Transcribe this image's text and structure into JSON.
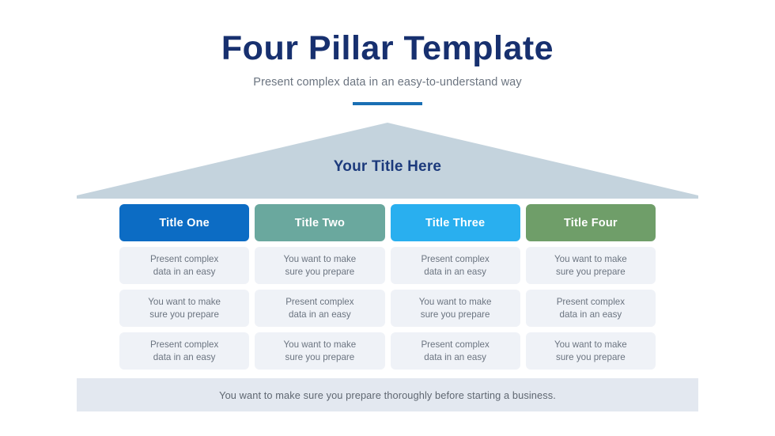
{
  "header": {
    "title": "Four Pillar Template",
    "subtitle": "Present complex data in an easy-to-understand way",
    "accent_color": "#1a6fb4",
    "title_color": "#17306f"
  },
  "roof": {
    "title": "Your Title Here",
    "fill_color": "#c4d3dd",
    "title_color": "#1c3a7c"
  },
  "columns": [
    {
      "title": "Title One",
      "color": "#0c6cc4",
      "cells": [
        "Present complex\ndata in an easy",
        "You want to make\nsure you prepare",
        "Present complex\ndata in an easy"
      ]
    },
    {
      "title": "Title Two",
      "color": "#6aa89e",
      "cells": [
        "You want to make\nsure you prepare",
        "Present complex\ndata in an easy",
        "You want to make\nsure you prepare"
      ]
    },
    {
      "title": "Title Three",
      "color": "#29afef",
      "cells": [
        "Present complex\ndata in an easy",
        "You want to make\nsure you prepare",
        "Present complex\ndata in an easy"
      ]
    },
    {
      "title": "Title Four",
      "color": "#6f9e69",
      "cells": [
        "You want to make\nsure you prepare",
        "Present complex\ndata in an easy",
        "You want to make\nsure you prepare"
      ]
    }
  ],
  "footer": {
    "text": "You want to make sure you prepare thoroughly before starting a business.",
    "background_color": "#e3e8f0"
  }
}
